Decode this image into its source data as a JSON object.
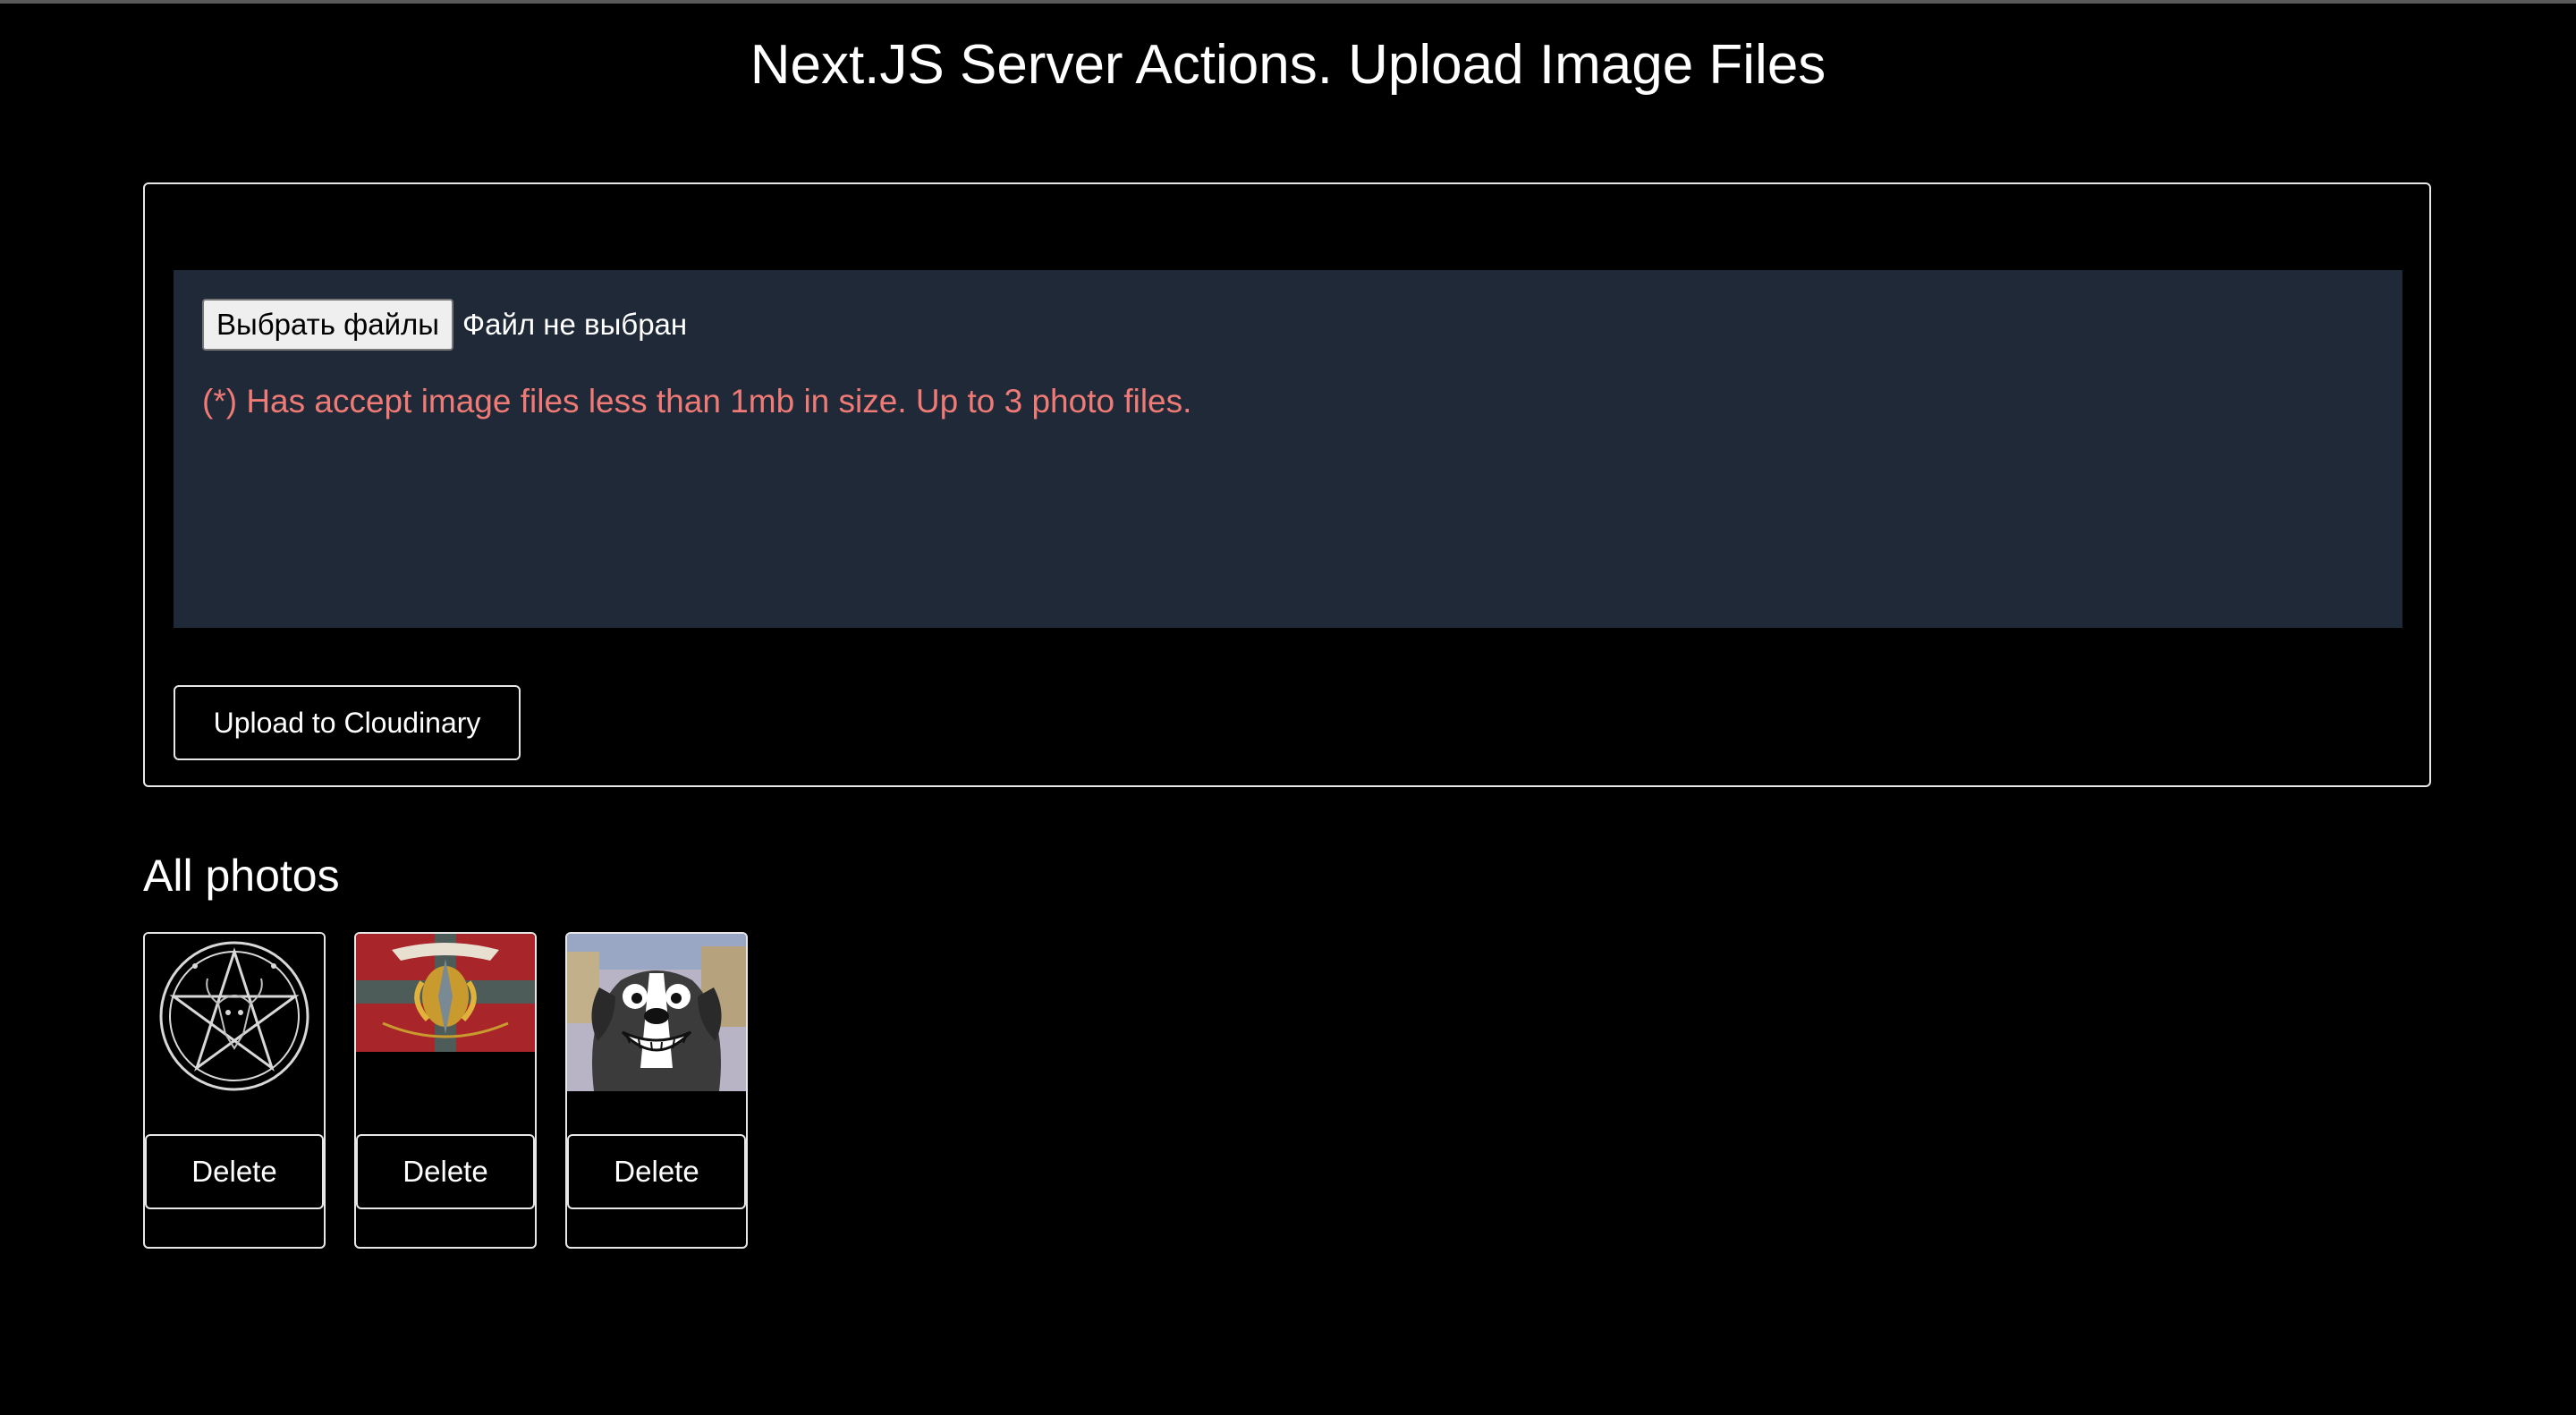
{
  "page": {
    "title": "Next.JS Server Actions. Upload Image Files"
  },
  "upload_form": {
    "choose_button_label": "Выбрать файлы",
    "file_status": "Файл не выбран",
    "hint": "(*) Has accept image files less than 1mb in size. Up to 3 photo files.",
    "submit_label": "Upload to Cloudinary"
  },
  "gallery": {
    "heading": "All photos",
    "photos": [
      {
        "thumbnail": "pentagram-goat-icon",
        "delete_label": "Delete"
      },
      {
        "thumbnail": "military-emblem-icon",
        "delete_label": "Delete"
      },
      {
        "thumbnail": "cartoon-dog-icon",
        "delete_label": "Delete"
      }
    ]
  },
  "colors": {
    "background": "#000000",
    "dropzone": "#1f2937",
    "hint_text": "#f07a76",
    "border": "#e8e8e8"
  }
}
